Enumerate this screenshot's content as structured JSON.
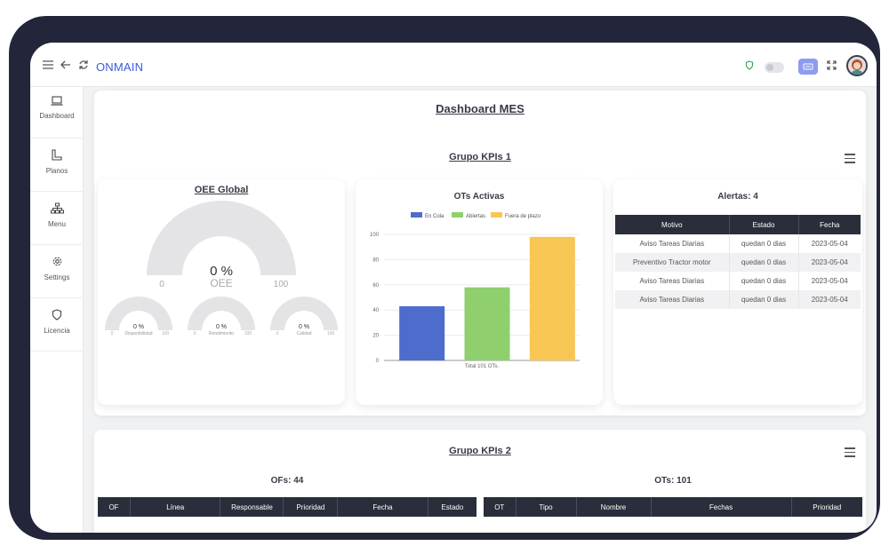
{
  "header": {
    "app_title": "ONMAIN"
  },
  "sidebar": {
    "items": [
      {
        "label": "Dashboard",
        "icon": "laptop-icon"
      },
      {
        "label": "Planos",
        "icon": "ruler-icon"
      },
      {
        "label": "Menu",
        "icon": "sitemap-icon"
      },
      {
        "label": "Settings",
        "icon": "gear-icon"
      },
      {
        "label": "Licencia",
        "icon": "shield-icon"
      }
    ]
  },
  "page": {
    "title": "Dashboard MES",
    "group1_title": "Grupo KPIs 1",
    "group2_title": "Grupo KPIs 2"
  },
  "oee": {
    "title": "OEE Global",
    "value": "0 %",
    "label": "OEE",
    "min": "0",
    "max": "100",
    "fill_fraction": 0,
    "small_gauges": [
      {
        "value": "0 %",
        "label": "Disponibilidad",
        "min": "0",
        "max": "100"
      },
      {
        "value": "0 %",
        "label": "Rendimiento",
        "min": "0",
        "max": "100"
      },
      {
        "value": "0 %",
        "label": "Calidad",
        "min": "0",
        "max": "100"
      }
    ]
  },
  "ots_activas": {
    "title": "OTs Activas"
  },
  "chart_data": {
    "type": "bar",
    "title": "OTs Activas",
    "categories": [
      "En Cola",
      "Abiertas",
      "Fuera de plazo"
    ],
    "values": [
      43,
      58,
      98
    ],
    "colors": [
      "#4e6ccc",
      "#8fcf6e",
      "#f7c653"
    ],
    "xlabel": "Total 101 OTs.",
    "ylim": [
      0,
      100
    ],
    "yticks": [
      "0",
      "20",
      "40",
      "60",
      "80",
      "100"
    ],
    "grid": true,
    "legend": "top",
    "legend_labels": [
      "En Cola",
      "Abiertas",
      "Fuera de plazo"
    ]
  },
  "alertas": {
    "title": "Alertas: 4",
    "columns": [
      "Motivo",
      "Estado",
      "Fecha"
    ],
    "rows": [
      [
        "Aviso Tareas Diarias",
        "quedan 0 dias",
        "2023-05-04"
      ],
      [
        "Preventivo Tractor motor",
        "quedan 0 dias",
        "2023-05-04"
      ],
      [
        "Aviso Tareas Diarias",
        "quedan 0 dias",
        "2023-05-04"
      ],
      [
        "Aviso Tareas Diarias",
        "quedan 0 dias",
        "2023-05-04"
      ]
    ]
  },
  "ofs": {
    "title": "OFs: 44",
    "columns": [
      "OF",
      "Línea",
      "Responsable",
      "Prioridad",
      "Fecha",
      "Estado"
    ]
  },
  "ots": {
    "title": "OTs: 101",
    "columns": [
      "OT",
      "Tipo",
      "Nombre",
      "Fechas",
      "Prioridad"
    ]
  }
}
